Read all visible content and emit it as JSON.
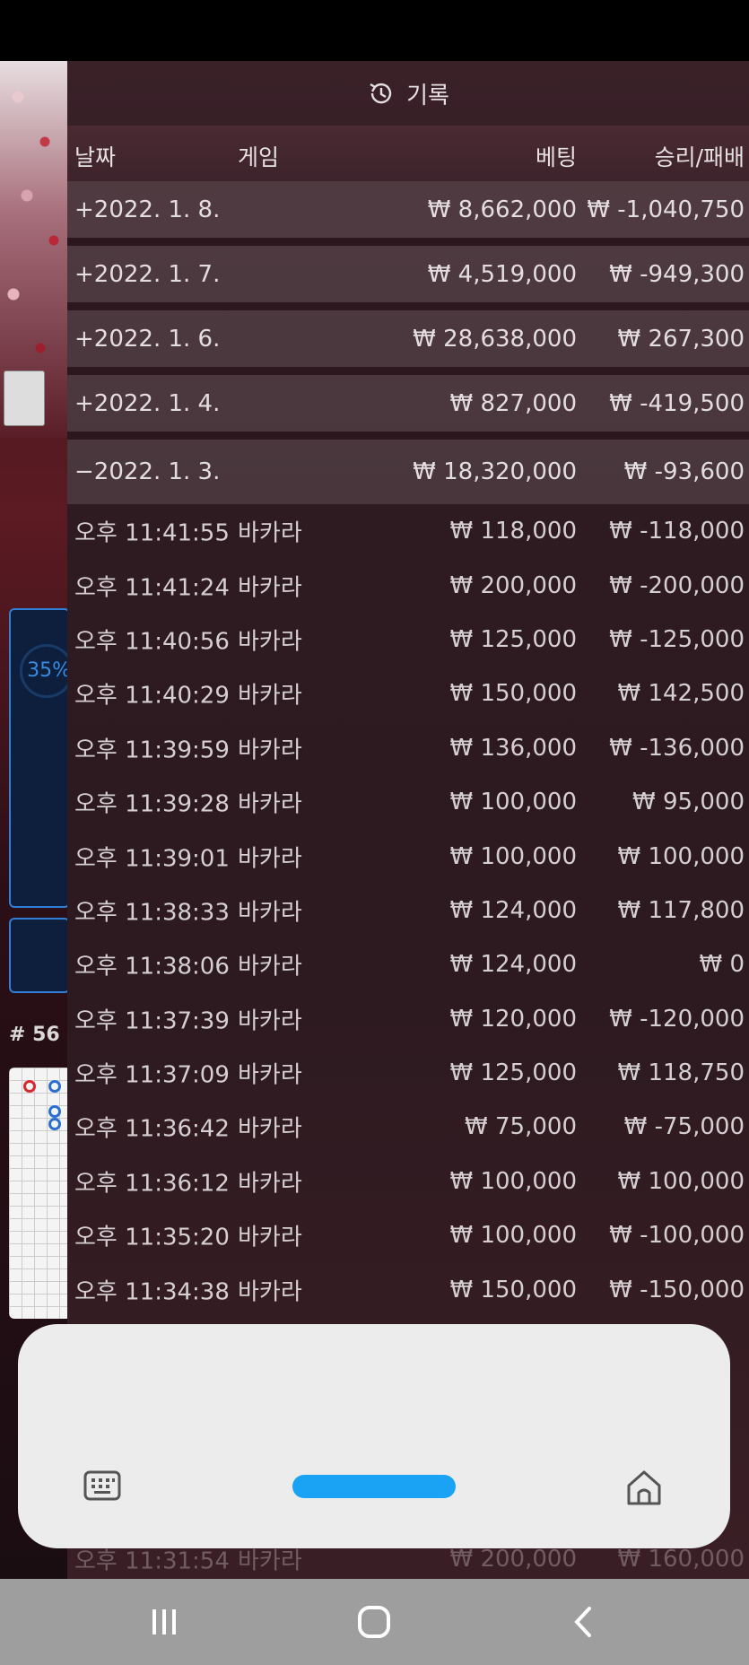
{
  "panel": {
    "title": "기록",
    "columns": {
      "date": "날짜",
      "game": "게임",
      "bet": "베팅",
      "result": "승리/패배"
    }
  },
  "days": [
    {
      "date": "+2022. 1. 8.",
      "bet": "₩ 8,662,000",
      "result": "₩ -1,040,750"
    },
    {
      "date": "+2022. 1. 7.",
      "bet": "₩ 4,519,000",
      "result": "₩ -949,300"
    },
    {
      "date": "+2022. 1. 6.",
      "bet": "₩ 28,638,000",
      "result": "₩ 267,300"
    },
    {
      "date": "+2022. 1. 4.",
      "bet": "₩ 827,000",
      "result": "₩ -419,500"
    },
    {
      "date": "−2022. 1. 3.",
      "bet": "₩ 18,320,000",
      "result": "₩ -93,600"
    }
  ],
  "details": [
    {
      "time": "오후 11:41:55",
      "game": "바카라",
      "bet": "₩ 118,000",
      "result": "₩ -118,000"
    },
    {
      "time": "오후 11:41:24",
      "game": "바카라",
      "bet": "₩ 200,000",
      "result": "₩ -200,000"
    },
    {
      "time": "오후 11:40:56",
      "game": "바카라",
      "bet": "₩ 125,000",
      "result": "₩ -125,000"
    },
    {
      "time": "오후 11:40:29",
      "game": "바카라",
      "bet": "₩ 150,000",
      "result": "₩ 142,500"
    },
    {
      "time": "오후 11:39:59",
      "game": "바카라",
      "bet": "₩ 136,000",
      "result": "₩ -136,000"
    },
    {
      "time": "오후 11:39:28",
      "game": "바카라",
      "bet": "₩ 100,000",
      "result": "₩ 95,000"
    },
    {
      "time": "오후 11:39:01",
      "game": "바카라",
      "bet": "₩ 100,000",
      "result": "₩ 100,000"
    },
    {
      "time": "오후 11:38:33",
      "game": "바카라",
      "bet": "₩ 124,000",
      "result": "₩ 117,800"
    },
    {
      "time": "오후 11:38:06",
      "game": "바카라",
      "bet": "₩ 124,000",
      "result": "₩ 0"
    },
    {
      "time": "오후 11:37:39",
      "game": "바카라",
      "bet": "₩ 120,000",
      "result": "₩ -120,000"
    },
    {
      "time": "오후 11:37:09",
      "game": "바카라",
      "bet": "₩ 125,000",
      "result": "₩ 118,750"
    },
    {
      "time": "오후 11:36:42",
      "game": "바카라",
      "bet": "₩ 75,000",
      "result": "₩ -75,000"
    },
    {
      "time": "오후 11:36:12",
      "game": "바카라",
      "bet": "₩ 100,000",
      "result": "₩ 100,000"
    },
    {
      "time": "오후 11:35:20",
      "game": "바카라",
      "bet": "₩ 100,000",
      "result": "₩ -100,000"
    },
    {
      "time": "오후 11:34:38",
      "game": "바카라",
      "bet": "₩ 150,000",
      "result": "₩ -150,000"
    }
  ],
  "partial_row": {
    "time": "오후 11:31:54",
    "game": "바카라",
    "bet": "₩ 200,000",
    "result": "₩ 160,000"
  },
  "background": {
    "percent": "35%",
    "round": "# 56"
  },
  "icons": {
    "history": "history-icon",
    "keyboard": "keyboard-icon",
    "home": "home-icon",
    "nav_recent": "recent-apps-icon",
    "nav_home": "nav-home-icon",
    "nav_back": "back-icon"
  },
  "colors": {
    "accent": "#1aa3f5",
    "navbar": "#9e9e9e"
  }
}
